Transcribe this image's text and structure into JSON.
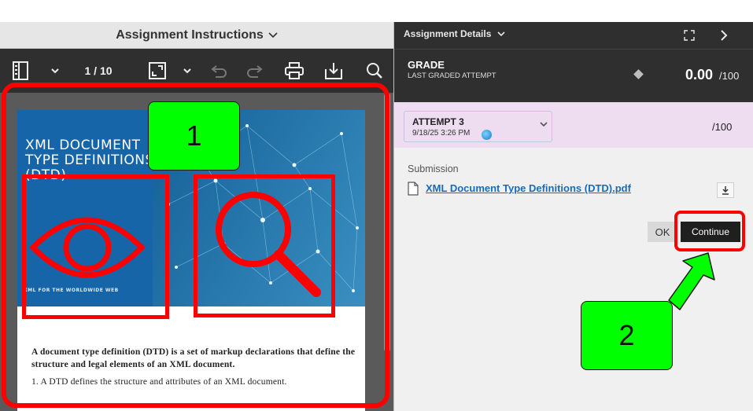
{
  "instructions_header": {
    "title": "Assignment Instructions",
    "chevron": "chevron-down-icon"
  },
  "toolbar": {
    "page_indicator": "1 / 10",
    "icons": [
      "sidebar-toggle-icon",
      "chevron-down-icon",
      "fullscreen-icon",
      "chevron-down-icon",
      "undo-icon",
      "redo-icon",
      "print-icon",
      "download-icon",
      "search-icon"
    ]
  },
  "document": {
    "cover_title_lines": [
      "XML DOCUMENT",
      "TYPE DEFINITIONS",
      "(DTD)"
    ],
    "cover_tagline": "XML FOR THE WORLDWIDE WEB",
    "paragraph_1": "A document type definition (DTD) is a set of markup declarations that define the structure and legal elements of an XML document.",
    "paragraph_2": "1. A DTD defines the structure and attributes of an XML document."
  },
  "details_bar": {
    "title": "Assignment Details",
    "chevron": "chevron-down-icon",
    "icons": [
      "expand-icon",
      "chevron-right-icon"
    ]
  },
  "grade": {
    "title": "GRADE",
    "subtitle": "LAST GRADED ATTEMPT",
    "score": "0.00",
    "max": "/100"
  },
  "attempt": {
    "label": "ATTEMPT 3",
    "date": "9/18/25 3:26 PM",
    "max": "/100"
  },
  "submission": {
    "label": "Submission",
    "file_name": "XML Document Type Definitions (DTD).pdf"
  },
  "buttons": {
    "ok": "OK",
    "continue": "Continue"
  },
  "annotations": {
    "callout_1": "1",
    "callout_2": "2",
    "colors": {
      "highlight": "#ff0000",
      "callout_fill": "#00ff00"
    }
  }
}
